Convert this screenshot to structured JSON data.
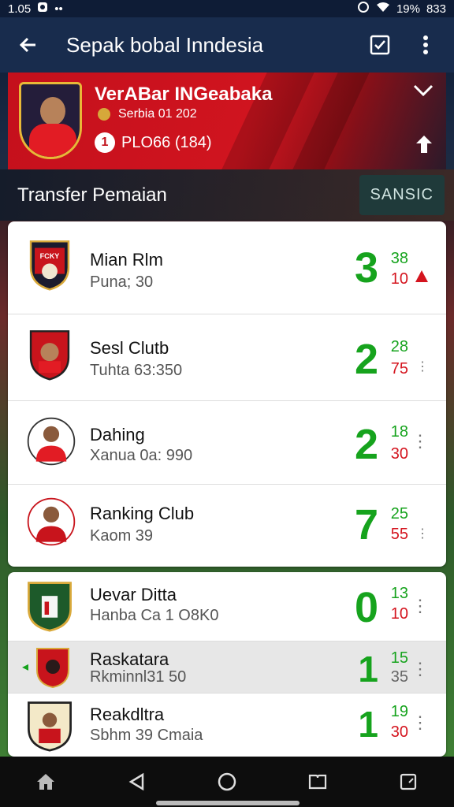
{
  "status_bar": {
    "time": "1.05",
    "battery": "19%",
    "clock_right": "833"
  },
  "app_bar": {
    "title": "Sepak bobal Inndesia"
  },
  "hero": {
    "name": "VerABar INGeabaka",
    "date": "Serbia 01 202",
    "rank_number": "1",
    "rank_text": "PLO66 (184)"
  },
  "section": {
    "title": "Transfer Pemaian",
    "button": "SANSIC"
  },
  "rows_card1": [
    {
      "name": "Mian Rlm",
      "sub": "Puna; 30",
      "big": "3",
      "top": "38",
      "bottom": "10"
    },
    {
      "name": "Sesl Clutb",
      "sub": "Tuhta 63:350",
      "big": "2",
      "top": "28",
      "bottom": "75"
    },
    {
      "name": "Dahing",
      "sub": "Xanua 0a: 990",
      "big": "2",
      "top": "18",
      "bottom": "30"
    },
    {
      "name": "Ranking Club",
      "sub": "Kaom 39",
      "big": "7",
      "top": "25",
      "bottom": "55"
    }
  ],
  "rows_card2": [
    {
      "name": "Uevar Ditta",
      "sub": "Hanba Ca 1 O8K0",
      "big": "0",
      "top": "13",
      "bottom": "10"
    },
    {
      "name": "Raskatara",
      "sub": "Rkminnl31 50",
      "big": "1",
      "top": "15",
      "bottom": "35"
    },
    {
      "name": "Reakdltra",
      "sub": "Sbhm 39 Cmaia",
      "big": "1",
      "top": "19",
      "bottom": "30"
    }
  ],
  "row1_logo_text": "FCKY",
  "colors": {
    "accent_green": "#16a31d",
    "accent_red": "#d4141e",
    "app_bar": "#182c4d",
    "hero_red": "#c4101c"
  }
}
